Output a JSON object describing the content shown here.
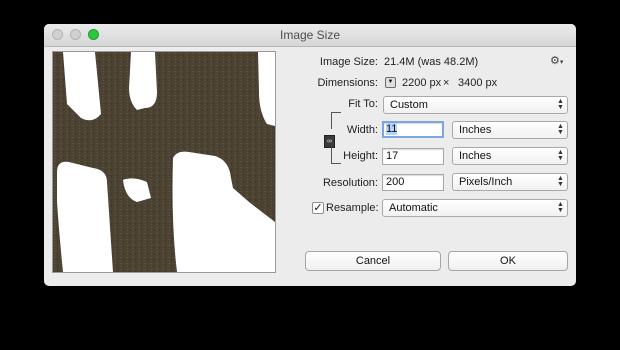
{
  "window": {
    "title": "Image Size"
  },
  "info": {
    "image_size_label": "Image Size:",
    "image_size_value": "21.4M (was 48.2M)",
    "dimensions_label": "Dimensions:",
    "dim_width": "2200 px",
    "dim_times": "×",
    "dim_height": "3400 px",
    "gear_icon": "gear-icon"
  },
  "fit_to": {
    "label": "Fit To:",
    "value": "Custom"
  },
  "width": {
    "label": "Width:",
    "value": "11",
    "unit": "Inches"
  },
  "height": {
    "label": "Height:",
    "value": "17",
    "unit": "Inches"
  },
  "resolution": {
    "label": "Resolution:",
    "value": "200",
    "unit": "Pixels/Inch"
  },
  "resample": {
    "label": "Resample:",
    "checked": true,
    "value": "Automatic"
  },
  "buttons": {
    "cancel": "Cancel",
    "ok": "OK"
  },
  "colors": {
    "close_light": "#d0d0d0",
    "zoom_light": "#2bc940",
    "focus_ring": "#7aa7e0",
    "preview_bg": "#4b4232"
  }
}
